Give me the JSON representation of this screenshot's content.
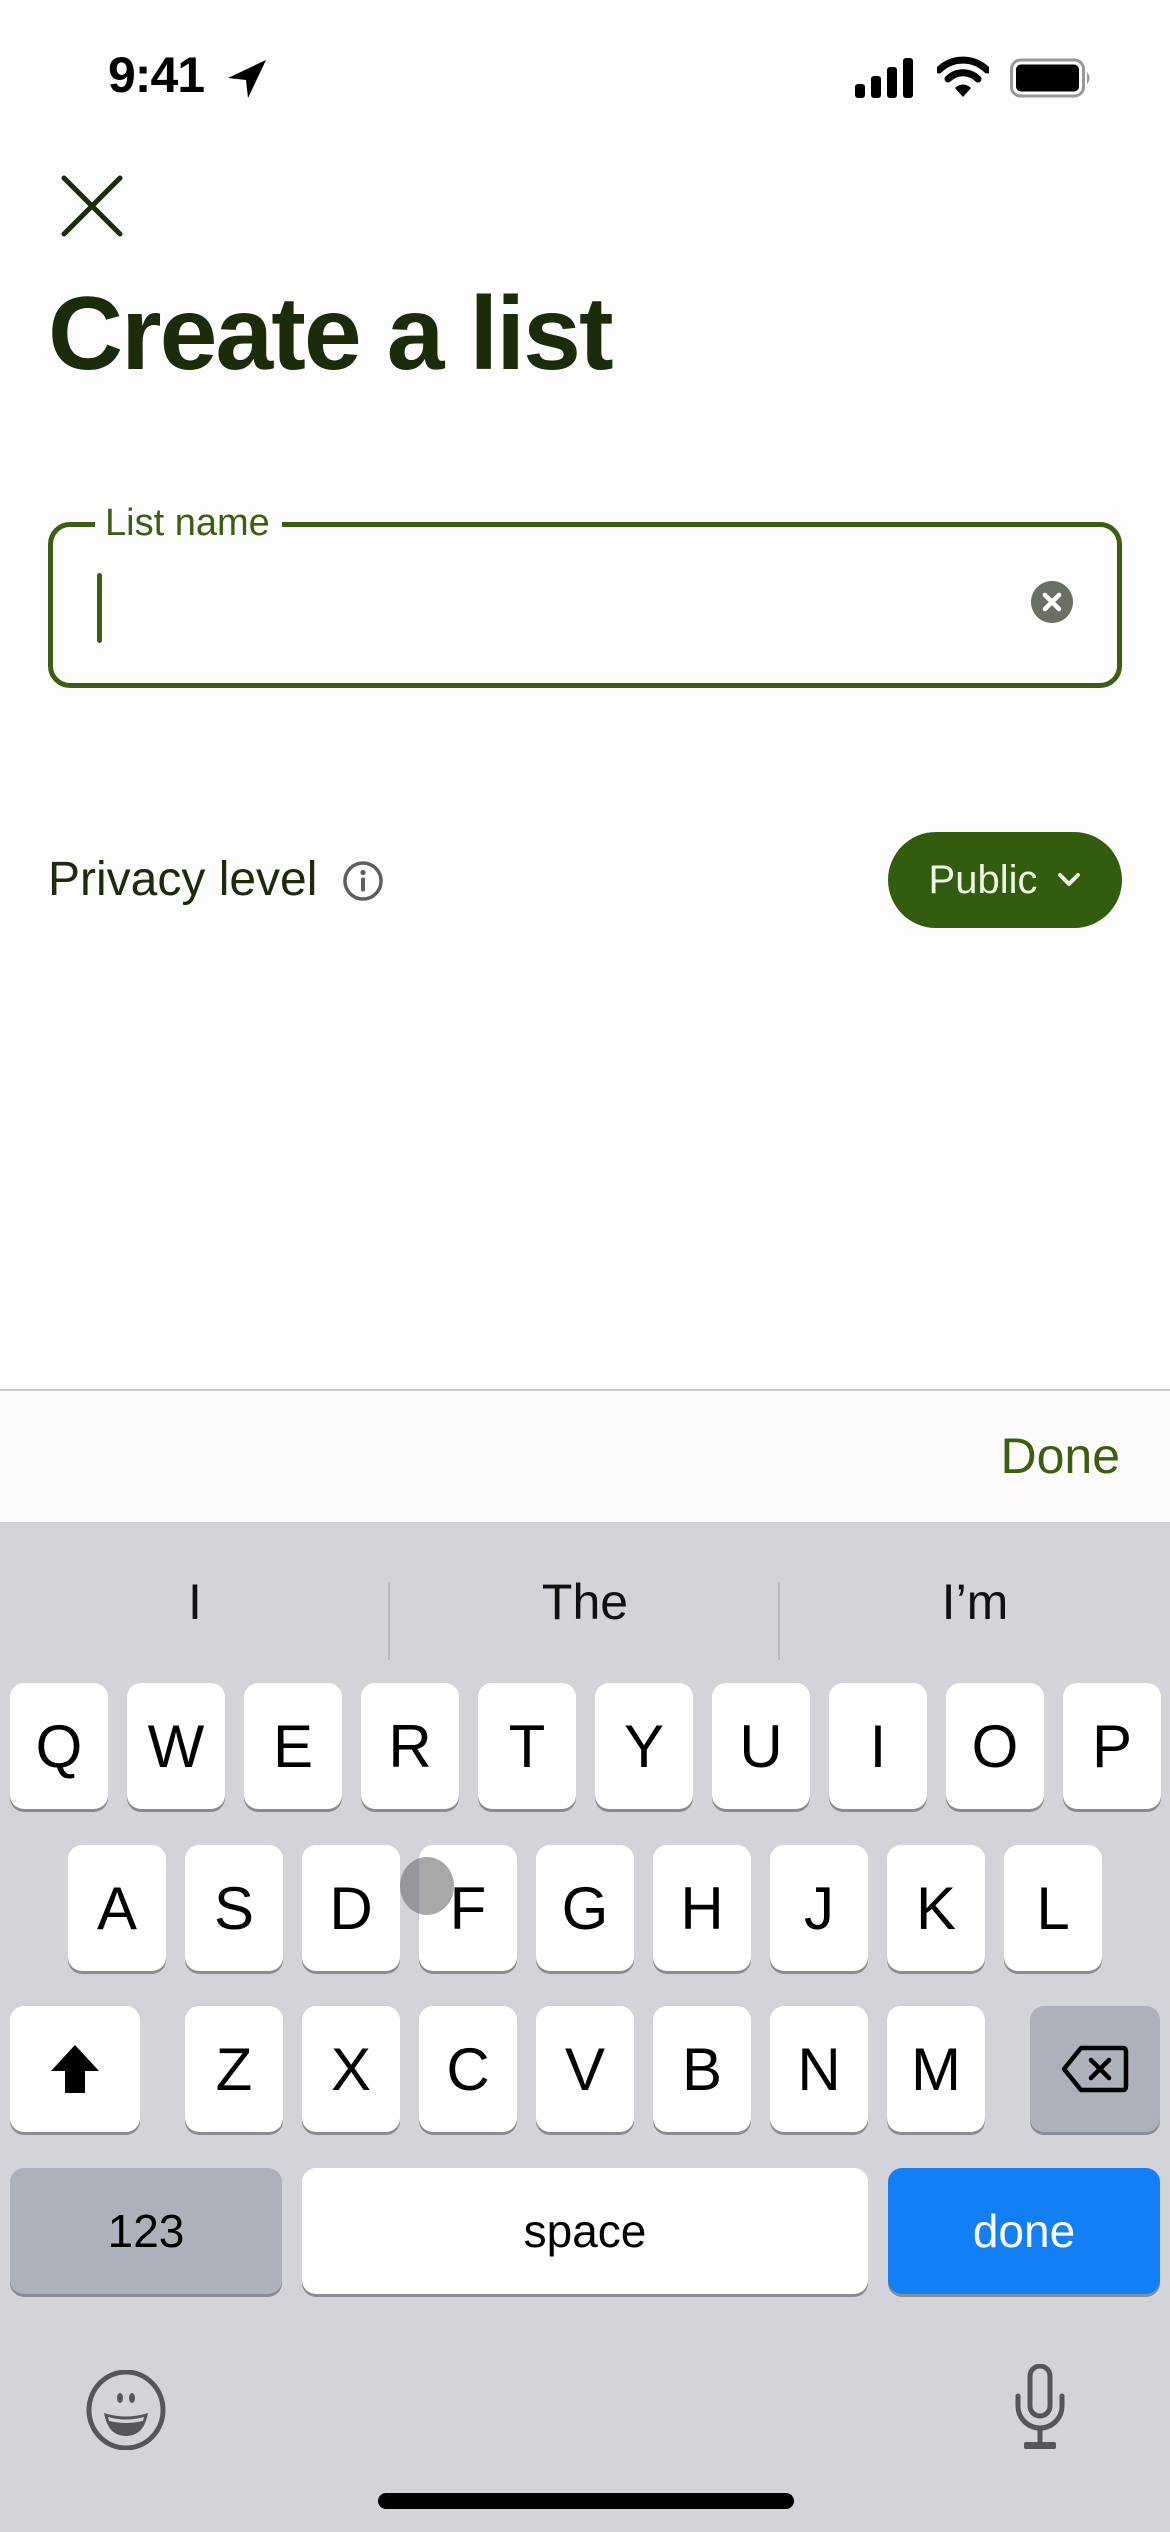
{
  "status_bar": {
    "time": "9:41"
  },
  "page": {
    "title": "Create a list"
  },
  "list_name_field": {
    "label": "List name",
    "value": "",
    "placeholder": ""
  },
  "privacy": {
    "label": "Privacy level",
    "selected": "Public"
  },
  "accessory": {
    "done_label": "Done"
  },
  "keyboard": {
    "suggestions": [
      "I",
      "The",
      "I’m"
    ],
    "row1": [
      "Q",
      "W",
      "E",
      "R",
      "T",
      "Y",
      "U",
      "I",
      "O",
      "P"
    ],
    "row2": [
      "A",
      "S",
      "D",
      "F",
      "G",
      "H",
      "J",
      "K",
      "L"
    ],
    "row3": [
      "Z",
      "X",
      "C",
      "V",
      "B",
      "N",
      "M"
    ],
    "numbers_label": "123",
    "space_label": "space",
    "return_label": "done"
  },
  "colors": {
    "accent": "#345c0f",
    "title": "#1c2b0a",
    "keyboard_return": "#137ff4"
  }
}
